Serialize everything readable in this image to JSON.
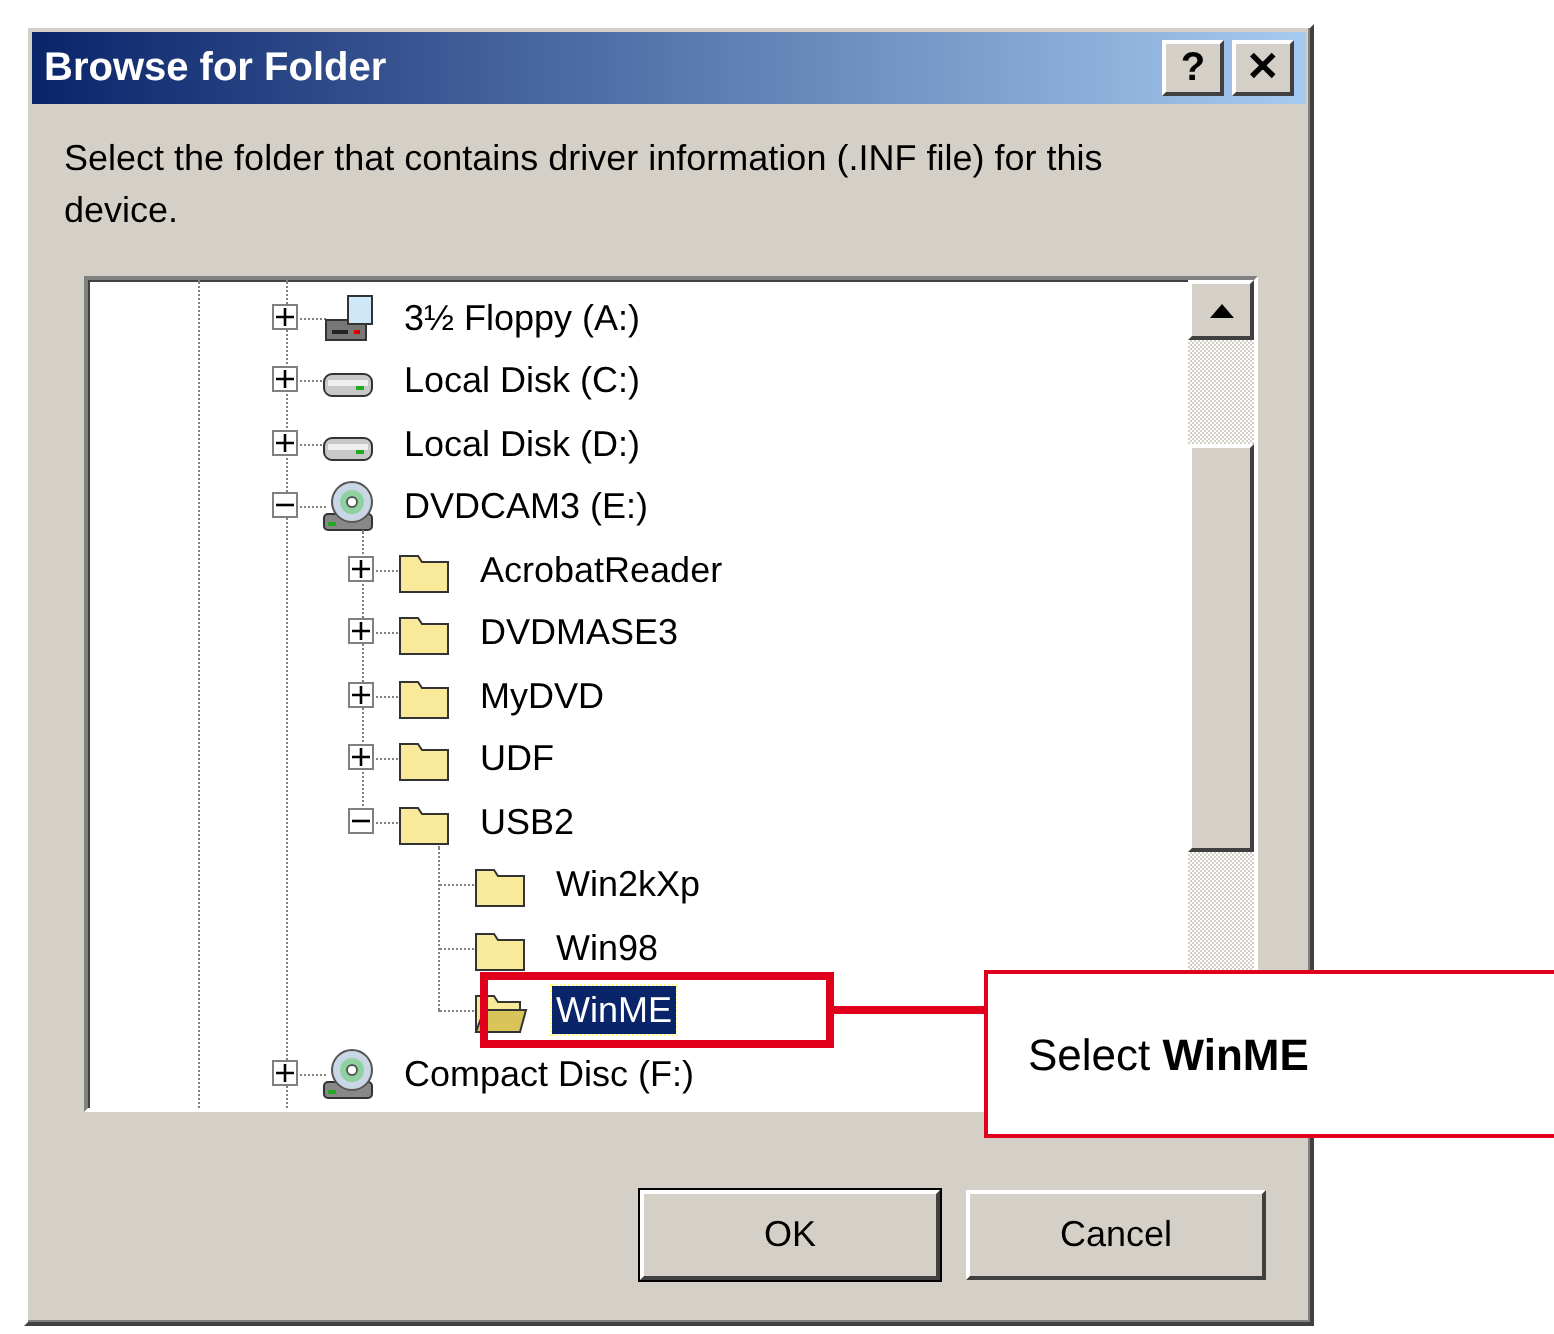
{
  "window": {
    "title": "Browse for Folder",
    "title_buttons": [
      {
        "label": "?"
      },
      {
        "label": "✕"
      }
    ]
  },
  "message": "Select the folder that contains driver information (.INF file) for this device.",
  "tree": [
    {
      "label": "3½ Floppy (A:)",
      "kind": "floppy",
      "expandable": true,
      "expanded": false,
      "selected": false
    },
    {
      "label": "Local Disk (C:)",
      "kind": "disk",
      "expandable": true,
      "expanded": false,
      "selected": false
    },
    {
      "label": "Local Disk (D:)",
      "kind": "disk",
      "expandable": true,
      "expanded": false,
      "selected": false
    },
    {
      "label": "DVDCAM3 (E:)",
      "kind": "cd",
      "expandable": true,
      "expanded": true,
      "selected": false,
      "children": [
        {
          "label": "AcrobatReader",
          "kind": "folder",
          "expandable": true,
          "expanded": false,
          "selected": false
        },
        {
          "label": "DVDMASE3",
          "kind": "folder",
          "expandable": true,
          "expanded": false,
          "selected": false
        },
        {
          "label": "MyDVD",
          "kind": "folder",
          "expandable": true,
          "expanded": false,
          "selected": false
        },
        {
          "label": "UDF",
          "kind": "folder",
          "expandable": true,
          "expanded": false,
          "selected": false
        },
        {
          "label": "USB2",
          "kind": "folder",
          "expandable": true,
          "expanded": true,
          "selected": false,
          "children": [
            {
              "label": "Win2kXp",
              "kind": "folder",
              "expandable": false,
              "expanded": false,
              "selected": false
            },
            {
              "label": "Win98",
              "kind": "folder",
              "expandable": false,
              "expanded": false,
              "selected": false
            },
            {
              "label": "WinME",
              "kind": "open-folder",
              "expandable": false,
              "expanded": false,
              "selected": true
            }
          ]
        }
      ]
    },
    {
      "label": "Compact Disc (F:)",
      "kind": "cd",
      "expandable": true,
      "expanded": false,
      "selected": false
    }
  ],
  "buttons": [
    {
      "label": "OK",
      "default": true
    },
    {
      "label": "Cancel",
      "default": false
    }
  ],
  "callout": {
    "text": "Select **WinME**"
  }
}
